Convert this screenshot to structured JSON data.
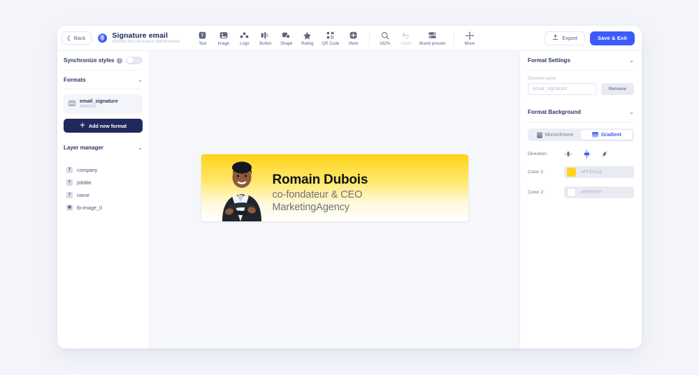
{
  "topbar": {
    "back_label": "Back",
    "doc_title": "Signature email",
    "doc_id": "d3dfdf00-5f12-441d-bdcd-7dd0084e83da",
    "tools": [
      {
        "label": "Text",
        "icon": "text-icon"
      },
      {
        "label": "Image",
        "icon": "image-icon"
      },
      {
        "label": "Logo",
        "icon": "logo-icon"
      },
      {
        "label": "Button",
        "icon": "button-icon"
      },
      {
        "label": "Shape",
        "icon": "shape-icon"
      },
      {
        "label": "Rating",
        "icon": "star-icon"
      },
      {
        "label": "QR Code",
        "icon": "qr-code-icon"
      },
      {
        "label": "More",
        "icon": "plus-circle-icon"
      }
    ],
    "zoom_label": "162%",
    "undo_label": "Undo",
    "brand_presets_label": "Brand presets",
    "move_label": "Move",
    "export_label": "Export",
    "save_label": "Save & Exit"
  },
  "sidebar": {
    "sync_label": "Synchronize styles",
    "formats_label": "Formats",
    "format_item": {
      "name": "email_signature",
      "size": "400x100",
      "icon": "format-icon"
    },
    "add_format_label": "Add new format",
    "layer_manager_label": "Layer manager",
    "layers": [
      {
        "label": "company",
        "icon": "text-layer-icon",
        "glyph": "T"
      },
      {
        "label": "jobtitle",
        "icon": "text-layer-icon",
        "glyph": "T"
      },
      {
        "label": "name",
        "icon": "text-layer-icon",
        "glyph": "T"
      },
      {
        "label": "tb-image_0",
        "icon": "image-layer-icon",
        "glyph": "▣"
      }
    ]
  },
  "canvas": {
    "banner": {
      "name": "Romain Dubois",
      "role": "co-fondateur & CEO",
      "company": "MarketingAgency",
      "gradient_from": "#FFD31A",
      "gradient_to": "#FFFFFF"
    }
  },
  "right_panel": {
    "format_settings_label": "Format Settings",
    "element_name_label": "Element name",
    "element_name_value": "email_signature",
    "rename_label": "Rename",
    "format_background_label": "Format Background",
    "segments": [
      {
        "label": "Monochrome",
        "active": false
      },
      {
        "label": "Gradient",
        "active": true
      }
    ],
    "direction_label": "Direction:",
    "directions": [
      {
        "name": "horizontal",
        "active": false
      },
      {
        "name": "vertical",
        "active": true
      },
      {
        "name": "diagonal",
        "active": false
      }
    ],
    "color1_label": "Color 1:",
    "color1_value": "#FFD31A",
    "color2_label": "Color 2:",
    "color2_value": "#FFFFFF",
    "accent": "#3b5bfd"
  }
}
